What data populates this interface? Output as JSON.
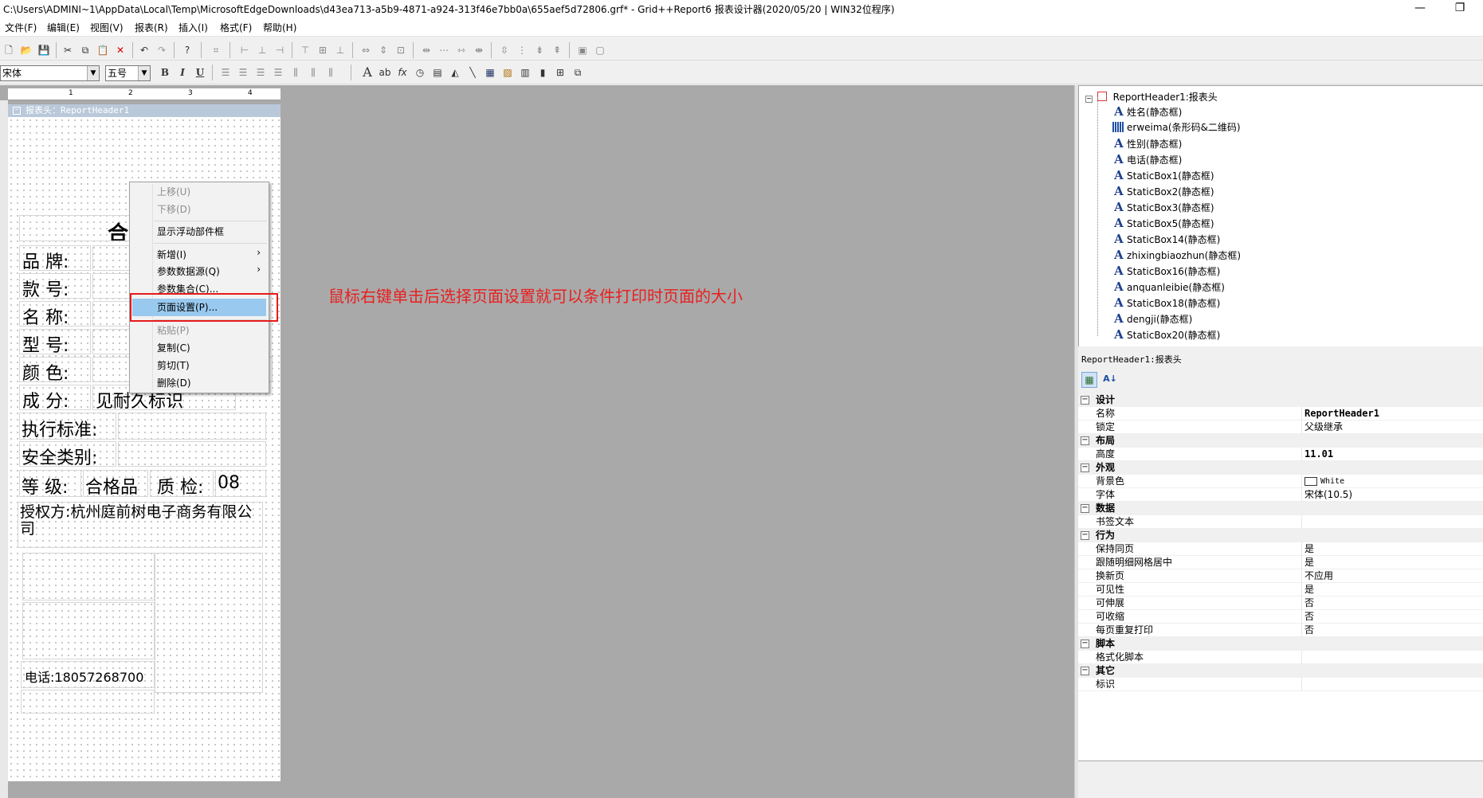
{
  "window": {
    "title": "C:\\Users\\ADMINI~1\\AppData\\Local\\Temp\\MicrosoftEdgeDownloads\\d43ea713-a5b9-4871-a924-313f46e7bb0a\\655aef5d72806.grf* - Grid++Report6 报表设计器(2020/05/20 | WIN32位程序)",
    "minimize": "—",
    "restore": "❐"
  },
  "menu": [
    "文件(F)",
    "编辑(E)",
    "视图(V)",
    "报表(R)",
    "插入(I)",
    "格式(F)",
    "帮助(H)"
  ],
  "toolbar2": {
    "font": "宋体",
    "size": "五号",
    "bold": "B",
    "italic": "I",
    "underline": "U"
  },
  "ruler": [
    "1",
    "2",
    "3",
    "4"
  ],
  "section": {
    "title": "报表头：ReportHeader1",
    "collapse": "−"
  },
  "design": {
    "title_partial": "合",
    "rows": [
      {
        "label": "品  牌:"
      },
      {
        "label": "款  号:"
      },
      {
        "label": "名  称:"
      },
      {
        "label": "型  号:"
      },
      {
        "label": "颜  色:"
      },
      {
        "label": "成  分:",
        "value": "见耐久标识"
      },
      {
        "label": "执行标准:"
      },
      {
        "label": "安全类别:"
      }
    ],
    "grade_label": "等  级:",
    "grade_value": "合格品",
    "qc_label": "质  检:",
    "qc_value": "08",
    "auth": "授权方:杭州庭前树电子商务有限公司",
    "phone": "电话:18057268700"
  },
  "context_menu": {
    "items": [
      {
        "label": "上移(U)",
        "disabled": true
      },
      {
        "label": "下移(D)",
        "disabled": true
      },
      {
        "label": "显示浮动部件框"
      },
      {
        "label": "新增(I)",
        "sub": "›"
      },
      {
        "label": "参数数据源(Q)",
        "sub": "›"
      },
      {
        "label": "参数集合(C)..."
      },
      {
        "label": "页面设置(P)...",
        "highlighted": true
      },
      {
        "label": "粘贴(P)",
        "disabled": true
      },
      {
        "label": "复制(C)"
      },
      {
        "label": "剪切(T)"
      },
      {
        "label": "删除(D)"
      }
    ]
  },
  "annotation": "鼠标右键单击后选择页面设置就可以条件打印时页面的大小",
  "tree": {
    "root": "ReportHeader1:报表头",
    "items": [
      {
        "label": "姓名(静态框)",
        "icon": "A"
      },
      {
        "label": "erweima(条形码&二维码)",
        "icon": "barcode"
      },
      {
        "label": "性别(静态框)",
        "icon": "A"
      },
      {
        "label": "电话(静态框)",
        "icon": "A"
      },
      {
        "label": "StaticBox1(静态框)",
        "icon": "A"
      },
      {
        "label": "StaticBox2(静态框)",
        "icon": "A"
      },
      {
        "label": "StaticBox3(静态框)",
        "icon": "A"
      },
      {
        "label": "StaticBox5(静态框)",
        "icon": "A"
      },
      {
        "label": "StaticBox14(静态框)",
        "icon": "A"
      },
      {
        "label": "zhixingbiaozhun(静态框)",
        "icon": "A"
      },
      {
        "label": "StaticBox16(静态框)",
        "icon": "A"
      },
      {
        "label": "anquanleibie(静态框)",
        "icon": "A"
      },
      {
        "label": "StaticBox18(静态框)",
        "icon": "A"
      },
      {
        "label": "dengji(静态框)",
        "icon": "A"
      },
      {
        "label": "StaticBox20(静态框)",
        "icon": "A"
      }
    ]
  },
  "props": {
    "title": "ReportHeader1:报表头",
    "groups": [
      {
        "name": "设计",
        "rows": [
          [
            "名称",
            "ReportHeader1",
            true
          ],
          [
            "锁定",
            "父级继承",
            false
          ]
        ]
      },
      {
        "name": "布局",
        "rows": [
          [
            "高度",
            "11.01",
            true
          ]
        ]
      },
      {
        "name": "外观",
        "rows": [
          [
            "背景色",
            "White",
            false
          ],
          [
            "字体",
            "宋体(10.5)",
            false
          ]
        ]
      },
      {
        "name": "数据",
        "rows": [
          [
            "书签文本",
            "",
            false
          ]
        ]
      },
      {
        "name": "行为",
        "rows": [
          [
            "保持同页",
            "是",
            false
          ],
          [
            "跟随明细网格居中",
            "是",
            false
          ],
          [
            "换新页",
            "不应用",
            false
          ],
          [
            "可见性",
            "是",
            false
          ],
          [
            "可伸展",
            "否",
            false
          ],
          [
            "可收缩",
            "否",
            false
          ],
          [
            "每页重复打印",
            "否",
            false
          ]
        ]
      },
      {
        "name": "脚本",
        "rows": [
          [
            "格式化脚本",
            "",
            false
          ]
        ]
      },
      {
        "name": "其它",
        "rows": [
          [
            "标识",
            "",
            false
          ]
        ]
      }
    ]
  }
}
